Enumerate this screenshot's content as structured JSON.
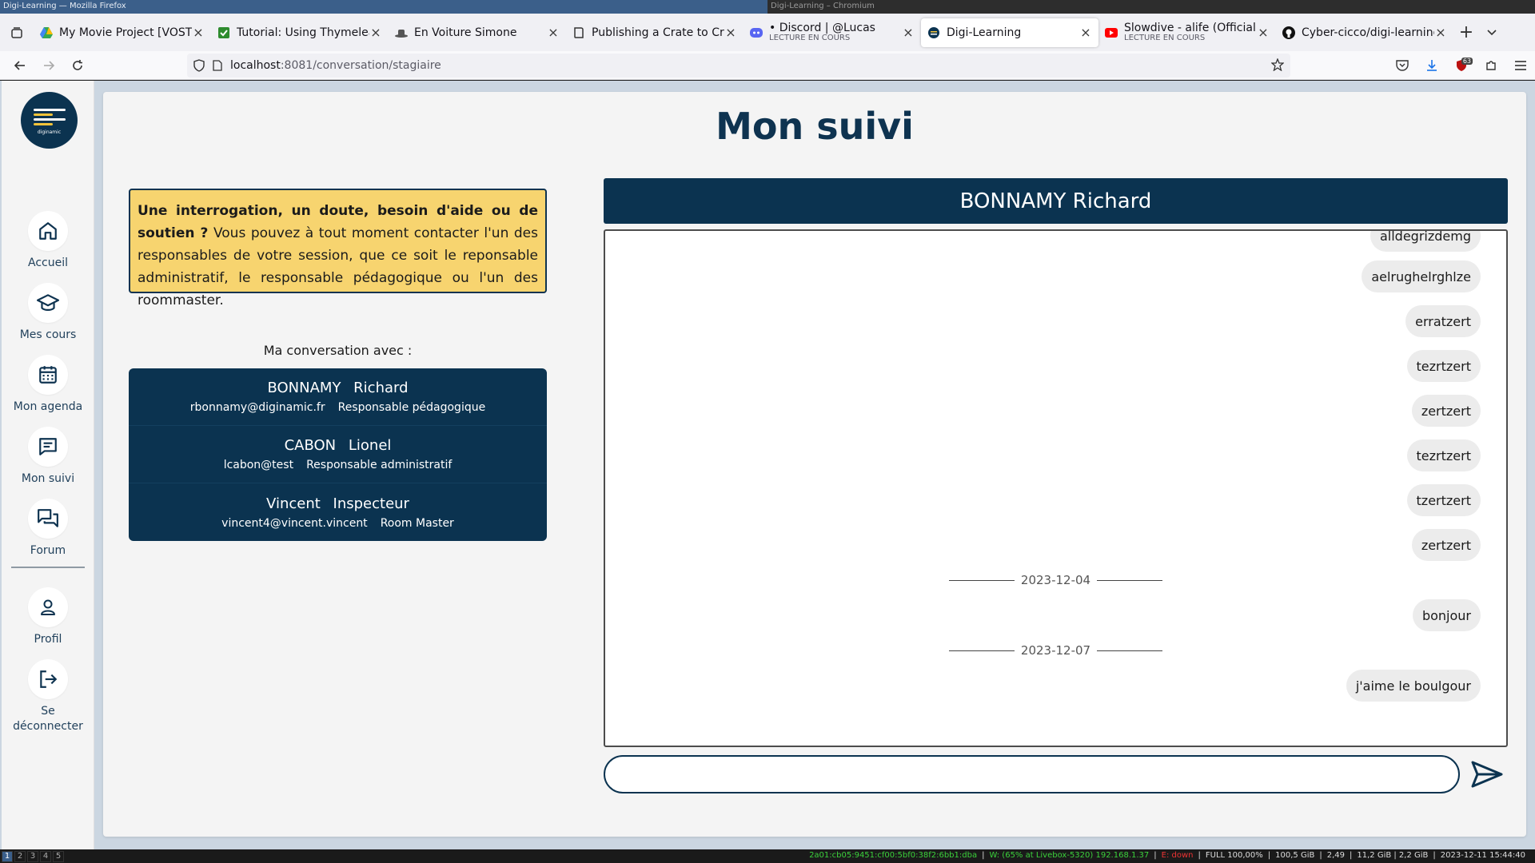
{
  "window": {
    "left_title": "Digi-Learning — Mozilla Firefox",
    "right_title": "Digi-Learning – Chromium"
  },
  "tabs": [
    {
      "title": "My Movie Project [VOSTFR]",
      "sub": "",
      "icon": "google-drive-icon",
      "color": "#34a853",
      "active": false
    },
    {
      "title": "Tutorial: Using Thymeleaf",
      "sub": "",
      "icon": "check-icon",
      "color": "#2e8b2e",
      "active": false
    },
    {
      "title": "En Voiture Simone",
      "sub": "",
      "icon": "hat-icon",
      "color": "#555555",
      "active": false
    },
    {
      "title": "Publishing a Crate to Crates",
      "sub": "",
      "icon": "book-icon",
      "color": "#333333",
      "active": false
    },
    {
      "title": "• Discord | @Lucas",
      "sub": "LECTURE EN COURS",
      "icon": "discord-icon",
      "color": "#5865f2",
      "active": false
    },
    {
      "title": "Digi-Learning",
      "sub": "",
      "icon": "digi-icon",
      "color": "#0b3350",
      "active": true
    },
    {
      "title": "Slowdive - alife (Official Video)",
      "sub": "LECTURE EN COURS",
      "icon": "youtube-icon",
      "color": "#ff0000",
      "active": false
    },
    {
      "title": "Cyber-cicco/digi-learning",
      "sub": "",
      "icon": "github-icon",
      "color": "#111111",
      "active": false
    }
  ],
  "url": {
    "host": "localhost",
    "path": ":8081/conversation/stagiaire"
  },
  "toolbar": {
    "notif_badge": "63"
  },
  "sidebar": {
    "logo_text": "diginamic",
    "items": [
      {
        "label": "Accueil",
        "icon": "home-icon"
      },
      {
        "label": "Mes cours",
        "icon": "graduation-cap-icon"
      },
      {
        "label": "Mon agenda",
        "icon": "calendar-icon"
      },
      {
        "label": "Mon suivi",
        "icon": "chat-bubble-icon"
      },
      {
        "label": "Forum",
        "icon": "forum-icon"
      },
      {
        "label": "Profil",
        "icon": "user-icon"
      },
      {
        "label": "Se déconnecter",
        "icon": "logout-icon"
      }
    ]
  },
  "main": {
    "title": "Mon suivi",
    "help": {
      "bold": "Une interrogation, un doute, besoin d'aide ou de soutien ?",
      "text": "Vous pouvez à tout moment contacter l'un des responsables de votre session, que ce soit le reponsable administratif, le responsable pédagogique ou l'un des roommaster."
    },
    "conversation_label": "Ma conversation avec :",
    "contacts": [
      {
        "name": "BONNAMY Richard",
        "email": "rbonnamy@diginamic.fr",
        "role": "Responsable pédagogique"
      },
      {
        "name": "CABON Lionel",
        "email": "lcabon@test",
        "role": "Responsable administratif"
      },
      {
        "name": "Vincent Inspecteur",
        "email": "vincent4@vincent.vincent",
        "role": "Room Master"
      }
    ]
  },
  "chat": {
    "header": "BONNAMY Richard",
    "messages": [
      "alldegrizdemg",
      "aelrughelrghlze",
      "erratzert",
      "tezrtzert",
      "zertzert",
      "tezrtzert",
      "tzertzert",
      "zertzert",
      "bonjour",
      "j'aime le boulgour"
    ],
    "dates": [
      "2023-12-04",
      "2023-12-07"
    ],
    "input_placeholder": ""
  },
  "statusbar": {
    "workspaces": [
      "1",
      "2",
      "3",
      "4",
      "5"
    ],
    "ipv6": "2a01:cb05:9451:cf00:5bf0:38f2:6bb1:dba",
    "wifi": "W: (65% at Livebox-5320) 192.168.1.37",
    "eth": "E: down",
    "battery": "FULL 100,00%",
    "disk": "100,5 GiB",
    "load": "2,49",
    "mem": "11,2 GiB | 2,2 GiB",
    "datetime": "2023-12-11 15:44:40"
  },
  "colors": {
    "navy": "#0b3350",
    "help_bg": "#f7d46f",
    "page_bg": "#cbd6e1"
  }
}
